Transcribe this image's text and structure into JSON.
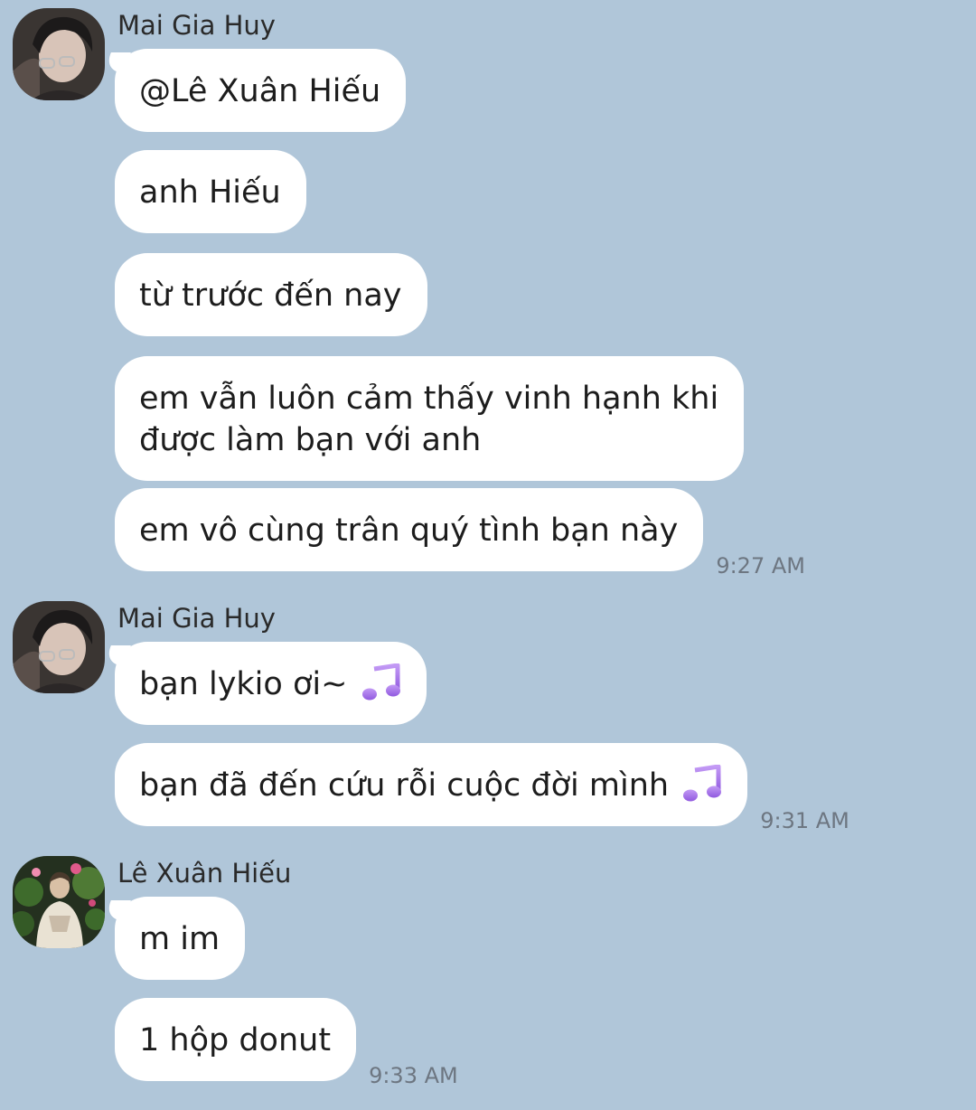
{
  "groups": [
    {
      "sender": "Mai Gia Huy",
      "avatar": "avatar-mai-gia-huy",
      "messages": [
        {
          "text": "@Lê Xuân Hiếu"
        },
        {
          "text": "anh Hiếu"
        },
        {
          "text": "từ trước đến nay"
        },
        {
          "line1": "em vẫn luôn cảm thấy vinh hạnh khi",
          "line2": "được làm bạn với anh"
        },
        {
          "text": "em vô cùng trân quý tình bạn này",
          "time": "9:27 AM"
        }
      ]
    },
    {
      "sender": "Mai Gia Huy",
      "avatar": "avatar-mai-gia-huy",
      "messages": [
        {
          "text": "bạn lykio ơi~",
          "icon": "musical-note-icon"
        },
        {
          "text": "bạn đã đến cứu rỗi cuộc đời mình",
          "icon": "musical-note-icon",
          "time": "9:31 AM"
        }
      ]
    },
    {
      "sender": "Lê Xuân Hiếu",
      "avatar": "avatar-le-xuan-hieu",
      "messages": [
        {
          "text": "m im"
        },
        {
          "text": "1 hộp donut",
          "time": "9:33 AM"
        }
      ]
    }
  ],
  "colors": {
    "background": "#b0c6d9",
    "bubble": "#ffffff",
    "timestamp": "#6d7681",
    "note_icon": "#a46ee6"
  }
}
